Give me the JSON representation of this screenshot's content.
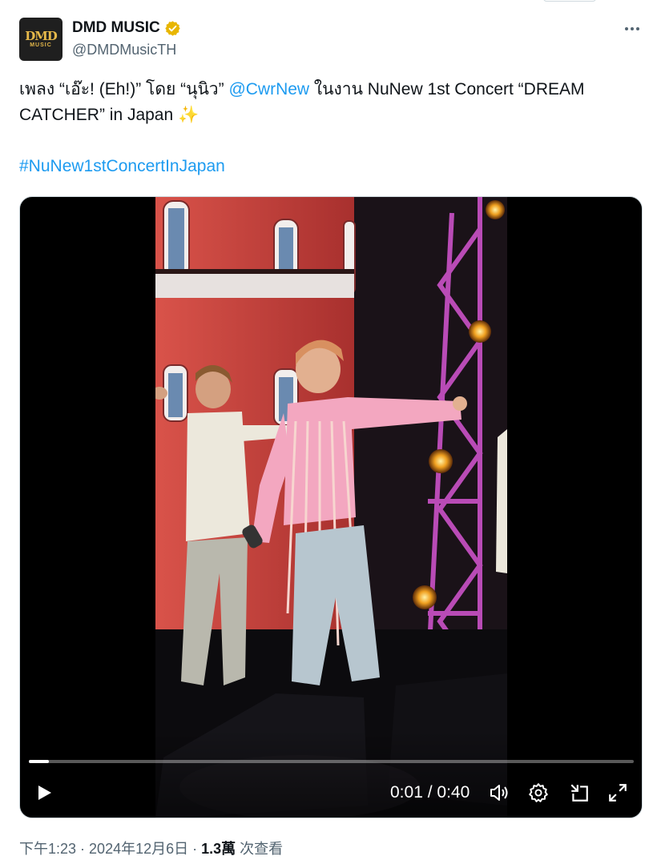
{
  "author": {
    "avatar_logo_top": "DMD",
    "avatar_logo_bottom": "MUSIC",
    "display_name": "DMD MUSIC",
    "handle": "@DMDMusicTH",
    "verified_color": "#e8b600"
  },
  "tweet": {
    "line1_prefix": "เพลง “เอ๊ะ! (Eh!)” โดย “นุนิว” ",
    "mention": "@CwrNew",
    "line1_suffix": " ในงาน NuNew 1st Concert “DREAM",
    "line2_text": "CATCHER” in Japan ",
    "emoji": "✨",
    "hashtag": "#NuNew1stConcertInJapan"
  },
  "video": {
    "current_time": "0:01",
    "separator": " / ",
    "duration": "0:40",
    "progress_fraction": 0.033,
    "icons": [
      "play-icon",
      "volume-icon",
      "settings-icon",
      "minimize-icon",
      "fullscreen-icon"
    ]
  },
  "meta": {
    "time": "下午1:23",
    "dot1": " · ",
    "date": "2024年12月6日",
    "dot2": " · ",
    "views_count": "1.3萬",
    "views_label": " 次查看"
  },
  "colors": {
    "link": "#1d9bf0",
    "text": "#0f1419",
    "secondary": "#536471"
  }
}
